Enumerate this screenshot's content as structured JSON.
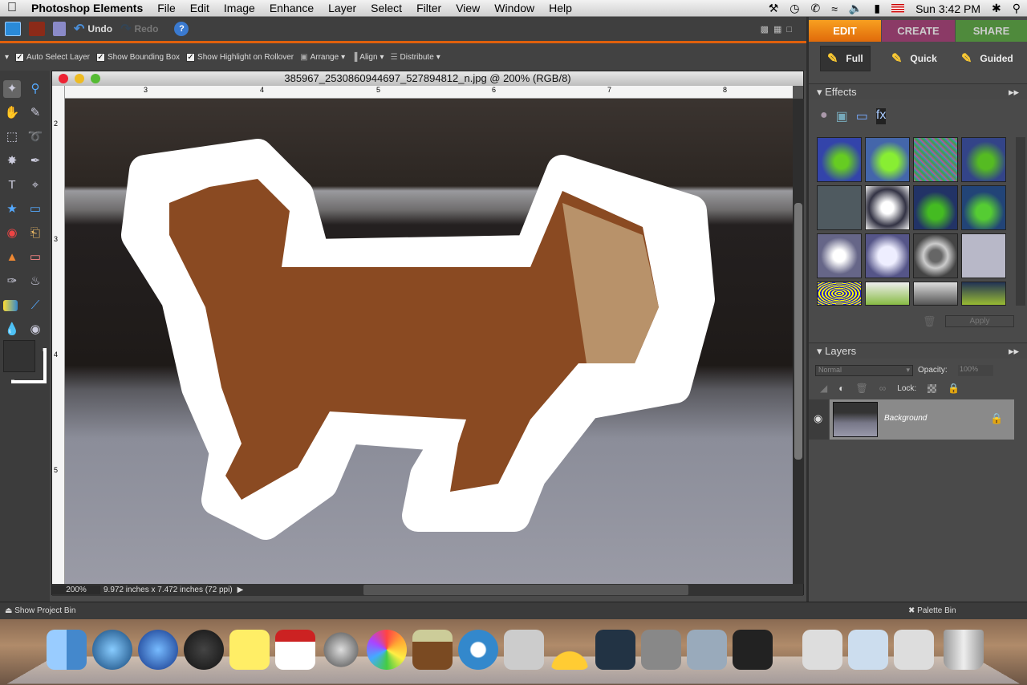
{
  "menubar": {
    "apple": "",
    "app": "Photoshop Elements",
    "items": [
      "File",
      "Edit",
      "Image",
      "Enhance",
      "Layer",
      "Select",
      "Filter",
      "View",
      "Window",
      "Help"
    ],
    "clock": "Sun 3:42 PM"
  },
  "toolbar": {
    "undo": "Undo",
    "redo": "Redo",
    "help": "?"
  },
  "options": {
    "auto_select": "Auto Select Layer",
    "bounding_box": "Show Bounding Box",
    "highlight": "Show Highlight on Rollover",
    "arrange": "Arrange",
    "align": "Align",
    "distribute": "Distribute"
  },
  "document": {
    "title": "385967_2530860944697_527894812_n.jpg @ 200% (RGB/8)",
    "zoom": "200%",
    "dimensions": "9.972 inches x 7.472 inches (72 ppi)",
    "ruler_top": [
      "3",
      "4",
      "5",
      "6",
      "7",
      "8"
    ],
    "ruler_left": [
      "2",
      "3",
      "4",
      "5"
    ]
  },
  "right": {
    "tabs": [
      "EDIT",
      "CREATE",
      "SHARE"
    ],
    "modes": [
      "Full",
      "Quick",
      "Guided"
    ],
    "effects_title": "Effects",
    "apply": "Apply",
    "layers_title": "Layers",
    "blend_mode": "Normal",
    "opacity_label": "Opacity:",
    "opacity": "100%",
    "lock_label": "Lock:",
    "layer_name": "Background"
  },
  "bottom": {
    "project_bin": "Show Project Bin",
    "palette_bin": "Palette Bin"
  },
  "colors": {
    "accent": "#e0600c",
    "edit_tab": "#f08a10",
    "create_tab": "#8b3a66",
    "share_tab": "#4f8a3c"
  }
}
